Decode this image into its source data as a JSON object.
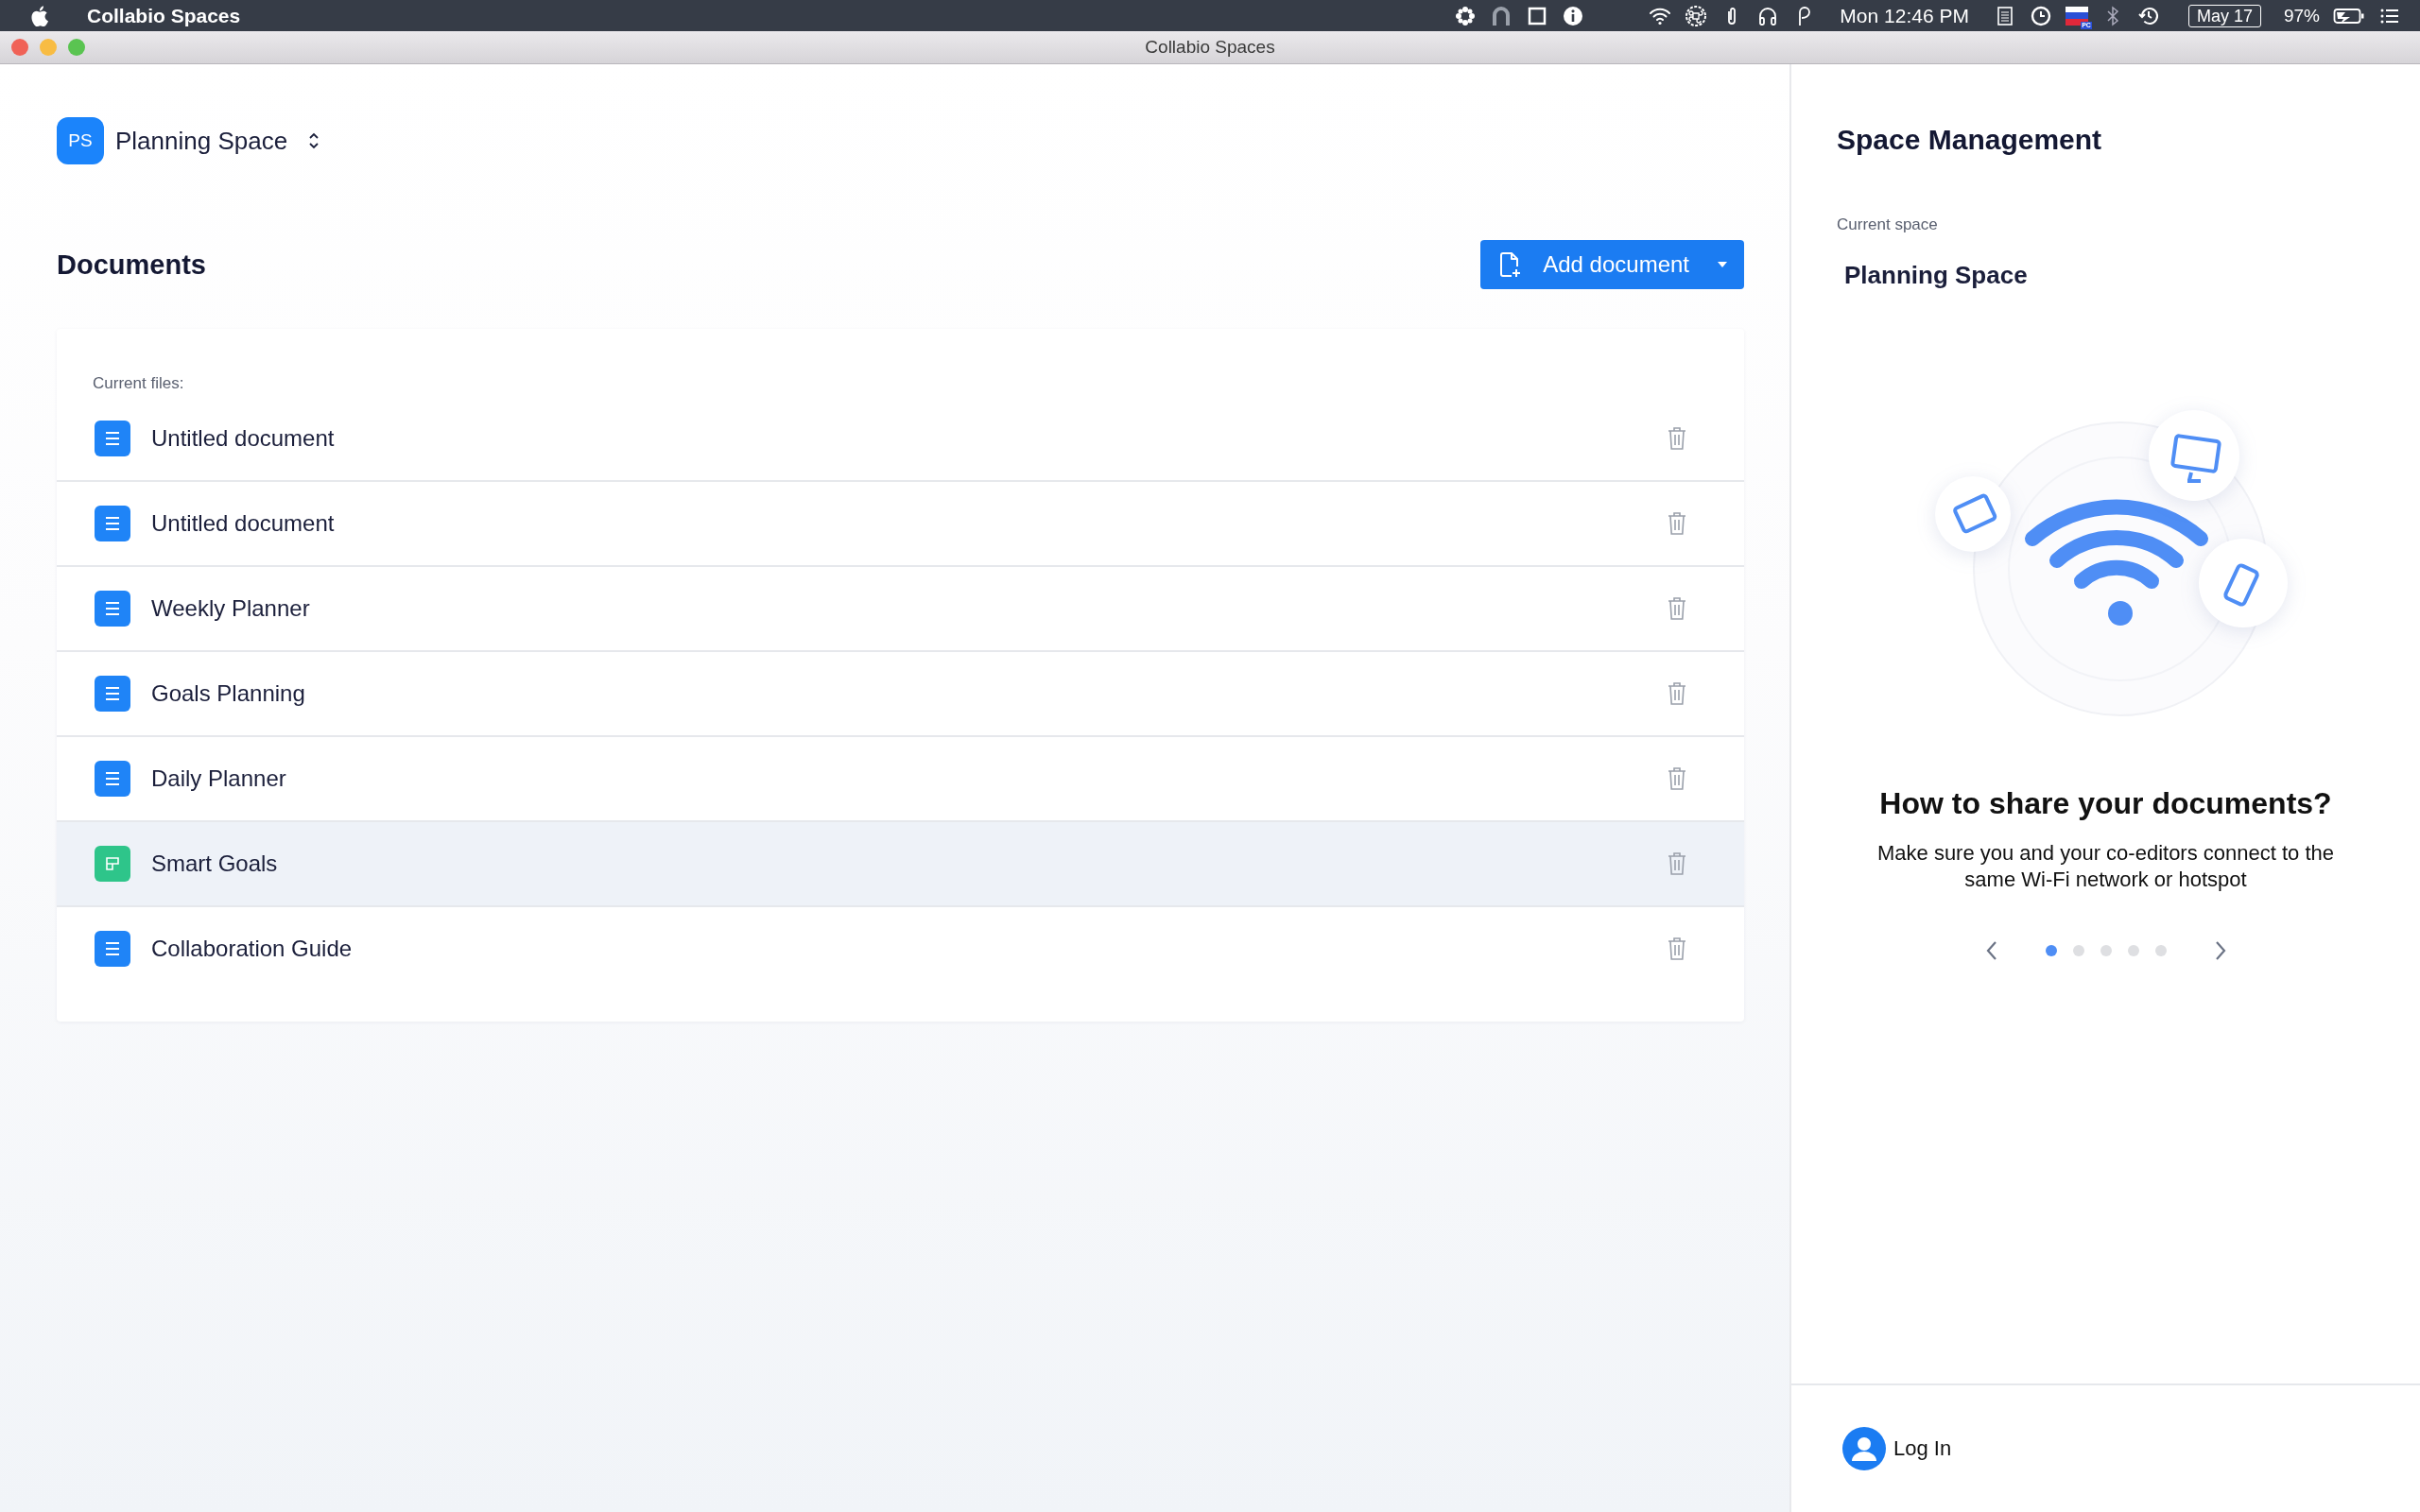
{
  "menu_bar": {
    "app_name": "Collabio Spaces",
    "clock": "Mon 12:46 PM",
    "flag_badge": "PC",
    "date": "May 17",
    "battery": "97%"
  },
  "window": {
    "title": "Collabio Spaces"
  },
  "space_switcher": {
    "initials": "PS",
    "name": "Planning Space"
  },
  "documents": {
    "title": "Documents",
    "add_button": "Add document",
    "section_label": "Current files:",
    "files": [
      {
        "name": "Untitled document",
        "kind": "doc",
        "selected": false
      },
      {
        "name": "Untitled document",
        "kind": "doc",
        "selected": false
      },
      {
        "name": "Weekly Planner",
        "kind": "doc",
        "selected": false
      },
      {
        "name": "Goals Planning",
        "kind": "doc",
        "selected": false
      },
      {
        "name": "Daily Planner",
        "kind": "doc",
        "selected": false
      },
      {
        "name": "Smart Goals",
        "kind": "table",
        "selected": true
      },
      {
        "name": "Collaboration Guide",
        "kind": "doc",
        "selected": false
      }
    ]
  },
  "space_management": {
    "title": "Space Management",
    "current_label": "Current space",
    "current_value": "Planning Space",
    "tip_title": "How to share your documents?",
    "tip_text": "Make sure you and your co-editors connect to the same Wi-Fi network or hotspot",
    "pages": [
      {
        "selected": true
      },
      {
        "selected": false
      },
      {
        "selected": false
      },
      {
        "selected": false
      },
      {
        "selected": false
      }
    ]
  },
  "login": {
    "label": "Log In"
  }
}
